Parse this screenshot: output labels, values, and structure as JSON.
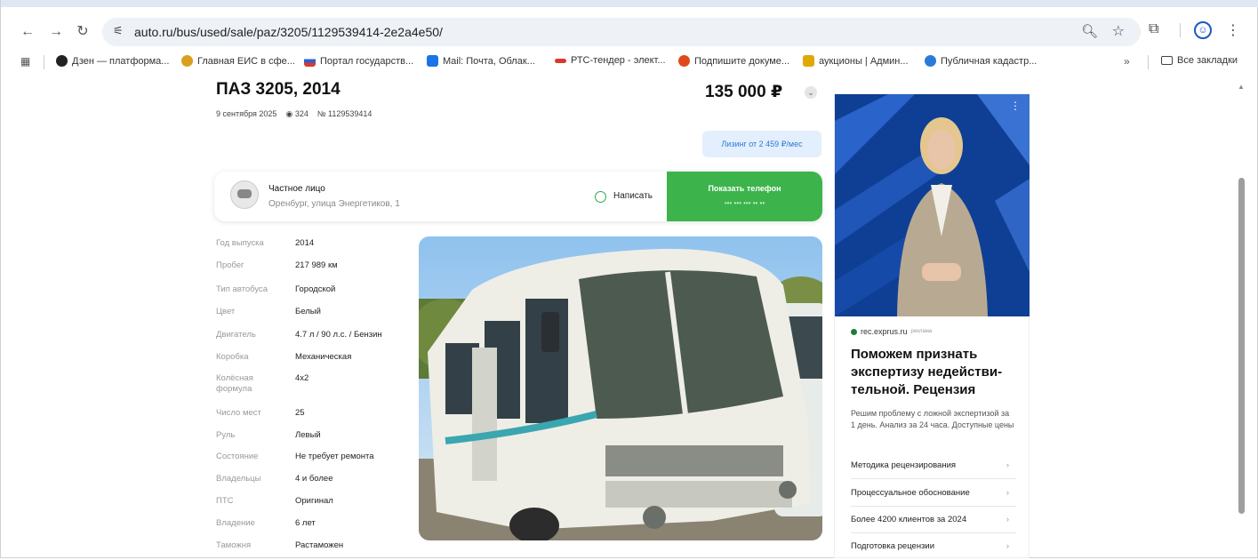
{
  "browser": {
    "url": "auto.ru/bus/used/sale/paz/3205/1129539414-2e2a4e50/",
    "bookmarks": [
      {
        "label": "Дзен — платформа...",
        "color": "#222222"
      },
      {
        "label": "Главная ЕИС в сфе...",
        "color": "#d9a020"
      },
      {
        "label": "Портал государств...",
        "color": "#2d5fd0"
      },
      {
        "label": "Mail: Почта, Облак...",
        "color": "#1a73e8"
      },
      {
        "label": "РТС-тендер - элект...",
        "color": "#d63b2f"
      },
      {
        "label": "Подпишите докуме...",
        "color": "#e04a1a"
      },
      {
        "label": "аукционы | Админ...",
        "color": "#e0a800"
      },
      {
        "label": "Публичная кадастр...",
        "color": "#2a7bd8"
      }
    ],
    "all_bookmarks": "Все закладки",
    "more": "»"
  },
  "listing": {
    "title": "ПАЗ 3205, 2014",
    "date": "9 сентября 2025",
    "views": "324",
    "number": "№ 1129539414",
    "price": "135 000 ₽",
    "leasing": "Лизинг от 2 459 ₽/мес"
  },
  "seller": {
    "name": "Частное лицо",
    "address": "Оренбург, улица Энергетиков, 1",
    "write": "Написать",
    "show_phone": "Показать телефон",
    "phone_mask": "••• ••• ••• •• ••"
  },
  "specs": [
    {
      "k": "Год выпуска",
      "v": "2014"
    },
    {
      "k": "Пробег",
      "v": "217 989 км"
    },
    {
      "k": "Тип автобуса",
      "v": "Городской"
    },
    {
      "k": "Цвет",
      "v": "Белый"
    },
    {
      "k": "Двигатель",
      "v": "4.7 л / 90 л.с. / Бензин"
    },
    {
      "k": "Коробка",
      "v": "Механическая"
    },
    {
      "k": "Колёсная формула",
      "v": "4x2"
    },
    {
      "k": "Число мест",
      "v": "25"
    },
    {
      "k": "Руль",
      "v": "Левый"
    },
    {
      "k": "Состояние",
      "v": "Не требует ремонта"
    },
    {
      "k": "Владельцы",
      "v": "4 и более"
    },
    {
      "k": "ПТС",
      "v": "Оригинал"
    },
    {
      "k": "Владение",
      "v": "6 лет"
    },
    {
      "k": "Таможня",
      "v": "Растаможен"
    }
  ],
  "ad": {
    "source": "rec.exprus.ru",
    "tag": "реклама",
    "headline": "Поможем признать экспертизу недействи-тельной. Рецензия",
    "description": "Решим проблему с ложной экспертизой за 1 день. Анализ за 24 часа. Доступные цены",
    "links": [
      "Методика рецензирования",
      "Процессуальное обоснование",
      "Более 4200 клиентов за 2024",
      "Подготовка рецензии"
    ]
  }
}
